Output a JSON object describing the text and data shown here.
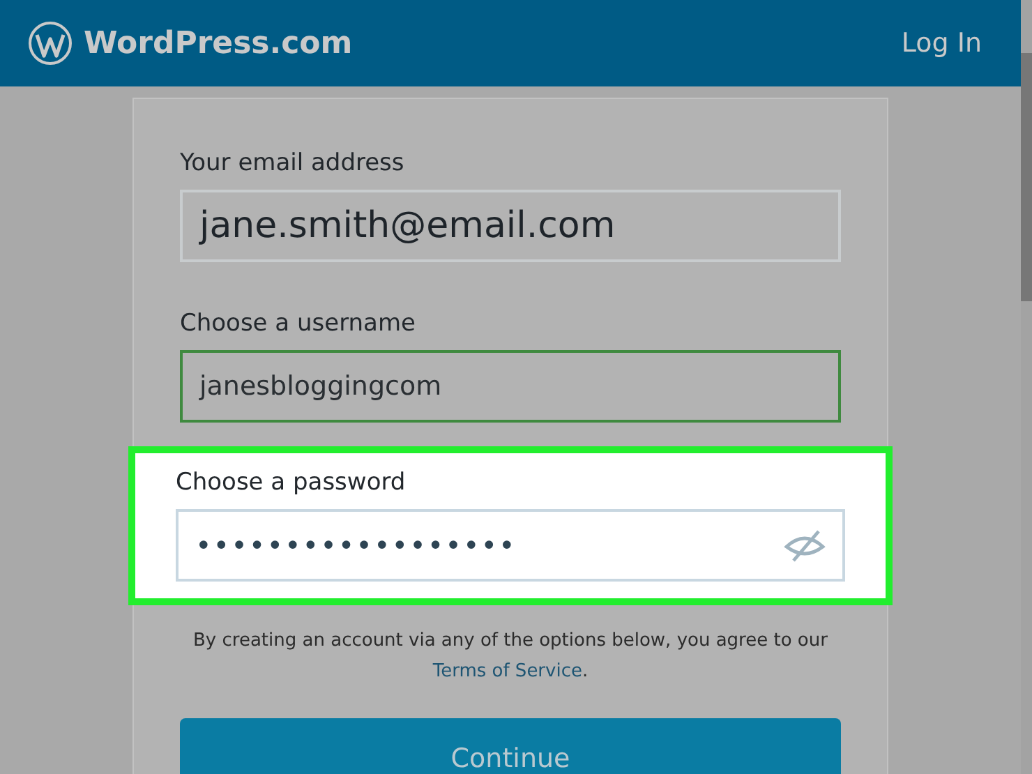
{
  "header": {
    "brand": "WordPress.com",
    "login": "Log In"
  },
  "fields": [
    {
      "label": "Your email address",
      "value": "jane.smith@email.com",
      "kind": "disabled",
      "highlighted": false
    },
    {
      "label": "Choose a username",
      "value": "janesbloggingcom",
      "kind": "valid",
      "highlighted": false
    },
    {
      "label": "Choose a password",
      "value": "••••••••••••••••••",
      "kind": "password",
      "highlighted": true
    }
  ],
  "disclaimer": "By creating an account via any of the options below, you agree to our",
  "terms_link": "Terms of Service",
  "terms_suffix": ".",
  "submit": "Continue"
}
